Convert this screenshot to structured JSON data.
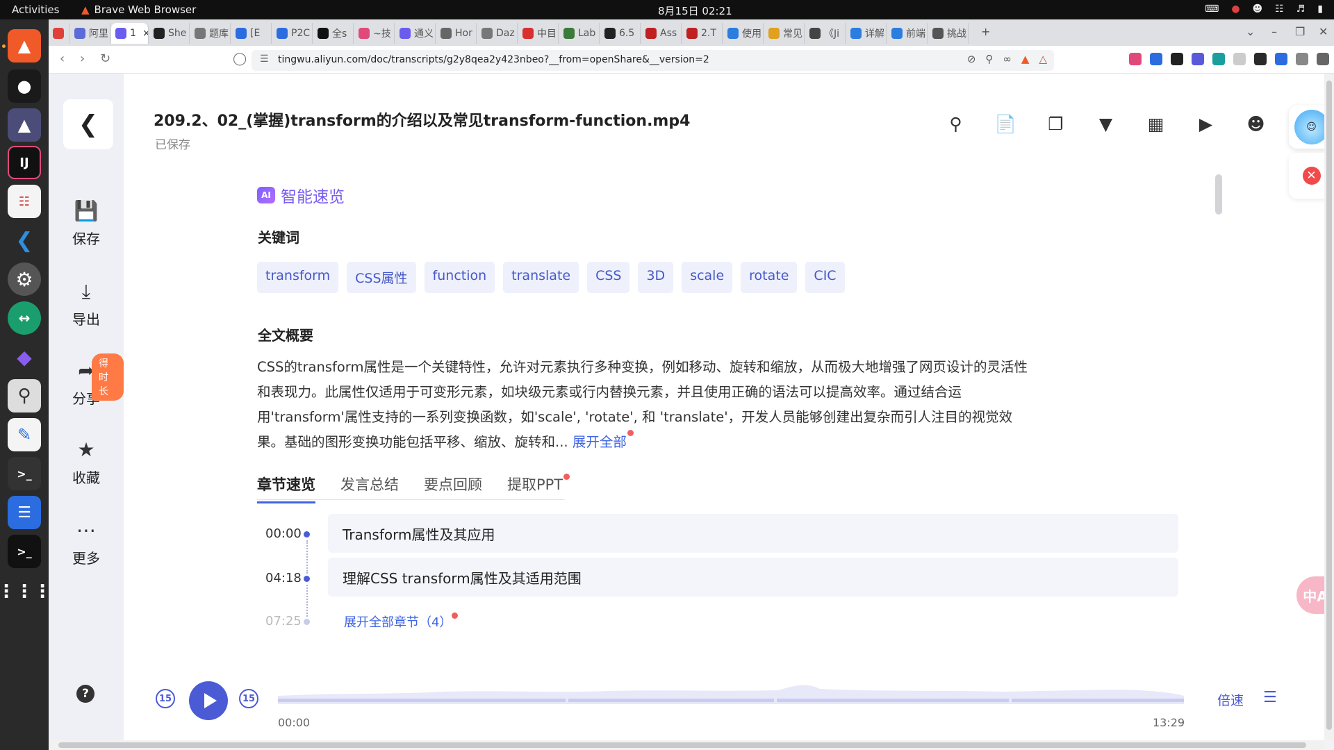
{
  "system": {
    "activities": "Activities",
    "app_name": "Brave Web Browser",
    "clock": "8月15日  02:21"
  },
  "browser": {
    "tabs": [
      {
        "label": "",
        "color": "#e0403a"
      },
      {
        "label": "阿里",
        "color": "#5b6bd8"
      },
      {
        "label": "1",
        "color": "#6b5cf0",
        "active": true
      },
      {
        "label": "She",
        "color": "#222222"
      },
      {
        "label": "题库",
        "color": "#777777"
      },
      {
        "label": "[E",
        "color": "#2b6de0"
      },
      {
        "label": "P2C",
        "color": "#2b6de0"
      },
      {
        "label": "全s",
        "color": "#111111"
      },
      {
        "label": "~技",
        "color": "#e04a7a"
      },
      {
        "label": "通义",
        "color": "#6b5cf0"
      },
      {
        "label": "Hor",
        "color": "#666666"
      },
      {
        "label": "Daz",
        "color": "#777777"
      },
      {
        "label": "中目",
        "color": "#d83030"
      },
      {
        "label": "Lab",
        "color": "#3a7a3a"
      },
      {
        "label": "6.5",
        "color": "#222222"
      },
      {
        "label": "Ass",
        "color": "#c02020"
      },
      {
        "label": "2.T",
        "color": "#c02020"
      },
      {
        "label": "使用",
        "color": "#2b7de0"
      },
      {
        "label": "常见",
        "color": "#e0a020"
      },
      {
        "label": "《Ji",
        "color": "#444444"
      },
      {
        "label": "详解",
        "color": "#2b7de0"
      },
      {
        "label": "前端",
        "color": "#2b7de0"
      },
      {
        "label": "挑战",
        "color": "#555555"
      }
    ],
    "url": "tingwu.aliyun.com/doc/transcripts/g2y8qea2y423nbeo?__from=openShare&__version=2"
  },
  "sidebar": {
    "items": [
      {
        "label": "保存",
        "icon": "save-icon"
      },
      {
        "label": "导出",
        "icon": "export-icon"
      },
      {
        "label": "分享",
        "icon": "share-icon"
      },
      {
        "label": "收藏",
        "icon": "star-icon"
      },
      {
        "label": "更多",
        "icon": "more-icon"
      }
    ],
    "share_badge": "得时长"
  },
  "doc": {
    "title": "209.2、02_(掌握)transform的介绍以及常见transform-function.mp4",
    "saved": "已保存"
  },
  "ai": {
    "badge": "AI",
    "label": "智能速览",
    "keywords_title": "关键词",
    "keywords": [
      "transform",
      "CSS属性",
      "function",
      "translate",
      "CSS",
      "3D",
      "scale",
      "rotate",
      "CIC"
    ],
    "summary_title": "全文概要",
    "summary": "CSS的transform属性是一个关键特性，允许对元素执行多种变换，例如移动、旋转和缩放，从而极大地增强了网页设计的灵活性和表现力。此属性仅适用于可变形元素，如块级元素或行内替换元素，并且使用正确的语法可以提高效率。通过结合运用'transform'属性支持的一系列变换函数，如'scale', 'rotate', 和 'translate'，开发人员能够创建出复杂而引人注目的视觉效果。基础的图形变换功能包括平移、缩放、旋转和...",
    "expand_all": "展开全部"
  },
  "content_tabs": [
    "章节速览",
    "发言总结",
    "要点回顾",
    "提取PPT"
  ],
  "chapters": [
    {
      "time": "00:00",
      "title": "Transform属性及其应用"
    },
    {
      "time": "04:18",
      "title": "理解CSS transform属性及其适用范围"
    }
  ],
  "chapters_fade_time": "07:25",
  "chapters_expand": "展开全部章节（4）",
  "player": {
    "rewind": "15",
    "forward": "15",
    "current": "00:00",
    "duration": "13:29",
    "speed": "倍速",
    "progress": 0
  },
  "floating": {
    "translate": "中A"
  },
  "colors": {
    "accent": "#4b5bd6",
    "ai": "#7a5cf0",
    "badge": "#ff7a45",
    "alert": "#f04a4a"
  }
}
